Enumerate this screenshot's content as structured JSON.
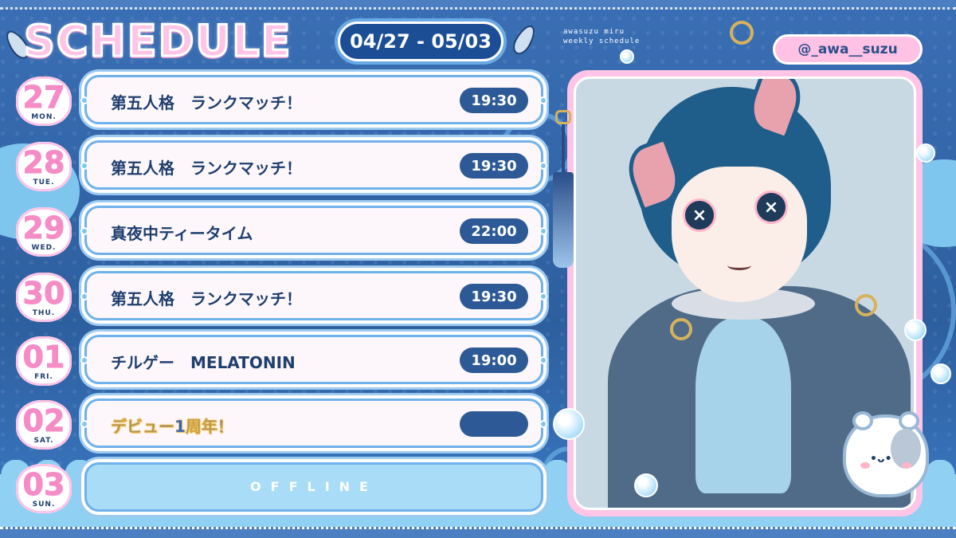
{
  "header": {
    "title": "SCHEDULE",
    "date_range": "04/27 - 05/03",
    "caption_line1": "awasuzu miru",
    "caption_line2": "weekly schedule",
    "handle": "@_awa__suzu"
  },
  "schedule": [
    {
      "day_num": "27",
      "day_name": "MON.",
      "event": "第五人格　ランクマッチ！",
      "time": "19:30"
    },
    {
      "day_num": "28",
      "day_name": "TUE.",
      "event": "第五人格　ランクマッチ！",
      "time": "19:30"
    },
    {
      "day_num": "29",
      "day_name": "WED.",
      "event": "真夜中ティータイム",
      "time": "22:00"
    },
    {
      "day_num": "30",
      "day_name": "THU.",
      "event": "第五人格　ランクマッチ！",
      "time": "19:30"
    },
    {
      "day_num": "01",
      "day_name": "FRI.",
      "event": "チルゲー　MELATONIN",
      "time": "19:00"
    },
    {
      "day_num": "02",
      "day_name": "SAT.",
      "event": "デビュー1周年！",
      "time": ""
    },
    {
      "day_num": "03",
      "day_name": "SUN.",
      "event": "OFFLINE",
      "time": ""
    }
  ],
  "colors": {
    "background": "#2f63a6",
    "accent_pink": "#ffc4e6",
    "day_number_pink": "#f58cc6",
    "time_pill": "#2d5a97",
    "card": "#fdf7fb",
    "offline_card": "#a8dcf7"
  },
  "icons": [
    "leaf-icon",
    "tassel-icon",
    "hamster-mascot-icon",
    "bubble-icon"
  ]
}
